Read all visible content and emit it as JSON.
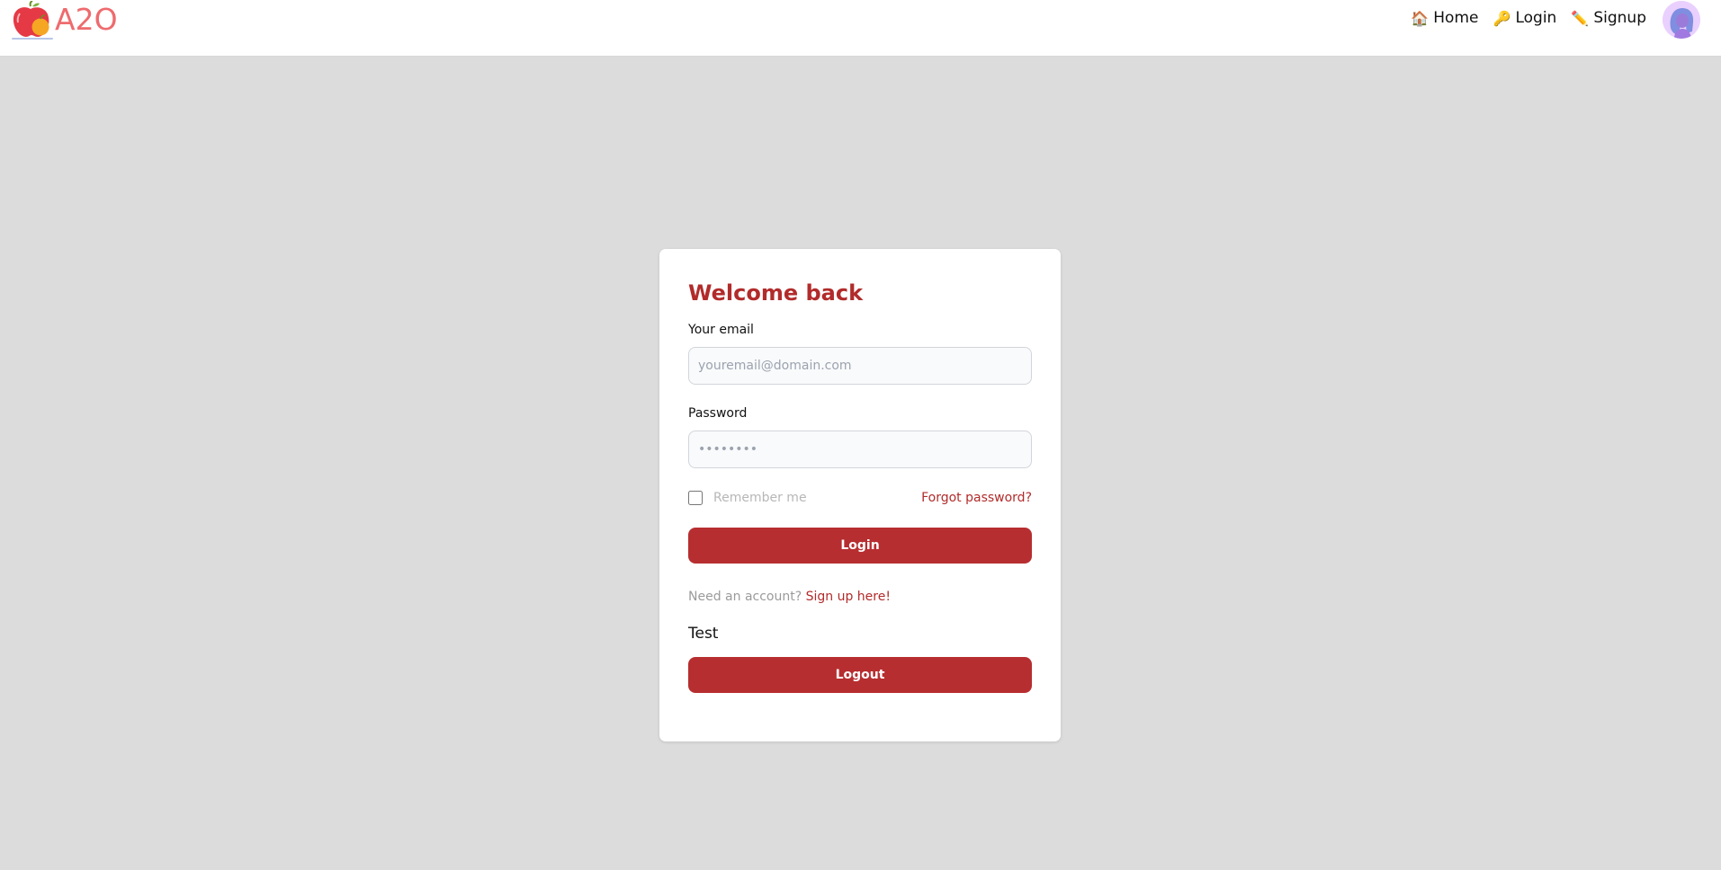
{
  "brand": {
    "name": "A2O",
    "color": "#ee6b6e"
  },
  "nav": {
    "items": [
      {
        "emoji": "🏠",
        "label": "Home",
        "icon": "home-icon"
      },
      {
        "emoji": "🔑",
        "label": "Login",
        "icon": "key-icon"
      },
      {
        "emoji": "✏️",
        "label": "Signup",
        "icon": "pencil-icon"
      }
    ]
  },
  "card": {
    "title": "Welcome back",
    "email_label": "Your email",
    "email_placeholder": "youremail@domain.com",
    "email_value": "",
    "password_label": "Password",
    "password_placeholder": "••••••••",
    "password_value": "",
    "remember_label": "Remember me",
    "remember_checked": false,
    "forgot_label": "Forgot password?",
    "login_button": "Login",
    "signup_prompt": "Need an account?",
    "signup_link": "Sign up here!",
    "user_name": "Test",
    "logout_button": "Logout"
  },
  "colors": {
    "accent": "#b72e30",
    "title": "#b22b2b",
    "background": "#dcdcdc"
  }
}
